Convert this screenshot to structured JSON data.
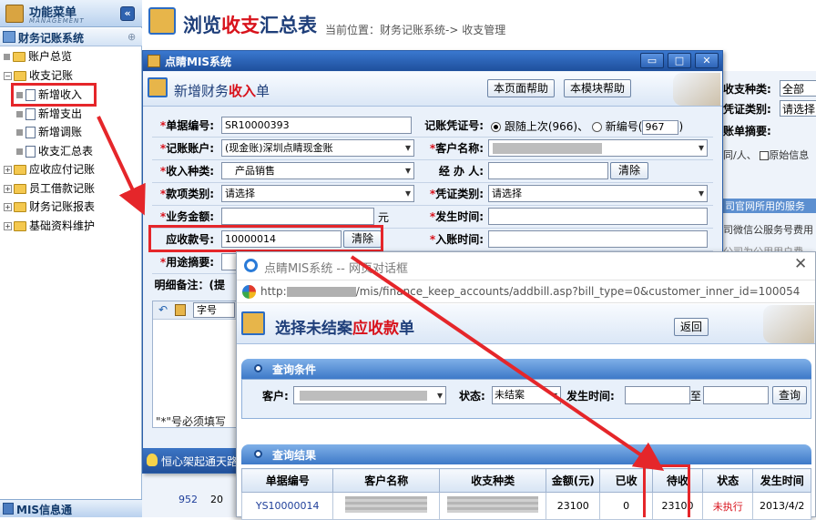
{
  "sidebar": {
    "header_title": "功能菜单",
    "header_sub": "MANAGEMENT",
    "section": "财务记账系统",
    "items": [
      {
        "label": "账户总览"
      },
      {
        "label": "收支记账"
      },
      {
        "label": "新增收入"
      },
      {
        "label": "新增支出"
      },
      {
        "label": "新增调账"
      },
      {
        "label": "收支汇总表"
      },
      {
        "label": "应收应付记账"
      },
      {
        "label": "员工借款记账"
      },
      {
        "label": "财务记账报表"
      },
      {
        "label": "基础资料维护"
      }
    ],
    "bottom": "MIS信息通"
  },
  "main": {
    "title_pre": "浏览",
    "title_red": "收支",
    "title_post": "汇总表",
    "breadcrumb": "当前位置：财务记账系统-> 收支管理",
    "bg_labels": {
      "type": "收支种类:",
      "type_value": "全部",
      "voucher": "凭证类别:",
      "voucher_value": "请选择",
      "summary": "账单摘要:",
      "person": "同/人、",
      "orig": "原始信息",
      "line1": "司官网所用的服务",
      "line2": "司微信公服务号费用",
      "line3": "公司为公用用户费",
      "row_id": "952",
      "row_id2": "20"
    }
  },
  "dialog1": {
    "window_title": "点睛MIS系统",
    "title_pre": "新增财务",
    "title_red": "收入",
    "title_post": "单",
    "help_page": "本页面帮助",
    "help_module": "本模块帮助",
    "fields": {
      "bill_no_label": "单据编号:",
      "bill_no_value": "SR10000393",
      "voucher_no_label": "记账凭证号:",
      "voucher_opt1": "跟随上次(966)、",
      "voucher_opt2": "新编号(",
      "voucher_new_value": "967",
      "voucher_paren": ")",
      "account_label": "记账账户:",
      "account_value": "(现金账)深圳点睛现金账",
      "customer_label": "客户名称:",
      "income_type_label": "收入种类:",
      "income_type_value": "产品销售",
      "handler_label": "经 办 人:",
      "clear": "清除",
      "category_label": "款项类别:",
      "category_value": "请选择",
      "voucher_type_label": "凭证类别:",
      "voucher_type_value": "请选择",
      "amount_label": "业务金额:",
      "amount_unit": "元",
      "occur_time_label": "发生时间:",
      "receivable_label": "应收款号:",
      "receivable_value": "10000014",
      "receivable_clear": "清除",
      "entry_time_label": "入账时间:",
      "purpose_label": "用途摘要:",
      "remark_label": "明细备注：(提",
      "font_label": "字号"
    },
    "required_note": "\"*\"号必须填写",
    "tip": "恒心架起通天路"
  },
  "dialog2": {
    "window_title": "点睛MIS系统 -- 网页对话框",
    "url_pre": "http:",
    "url_post": "/mis/finance_keep_accounts/addbill.asp?bill_type=0&customer_inner_id=100054",
    "title_pre": "选择未结案",
    "title_red": "应收款",
    "title_post": "单",
    "back": "返回",
    "query_panel": "查询条件",
    "customer_label": "客户:",
    "status_label": "状态:",
    "status_value": "未结案",
    "time_label": "发生时间:",
    "to_label": "至",
    "query_btn": "查询",
    "result_panel": "查询结果",
    "columns": [
      "单据编号",
      "客户名称",
      "收支种类",
      "金额(元)",
      "已收",
      "待收",
      "状态",
      "发生时间"
    ],
    "rows": [
      {
        "id": "YS10000014",
        "amount": "23100",
        "received": "0",
        "pending": "23100",
        "status": "未执行",
        "date": "2013/4/2"
      }
    ]
  }
}
